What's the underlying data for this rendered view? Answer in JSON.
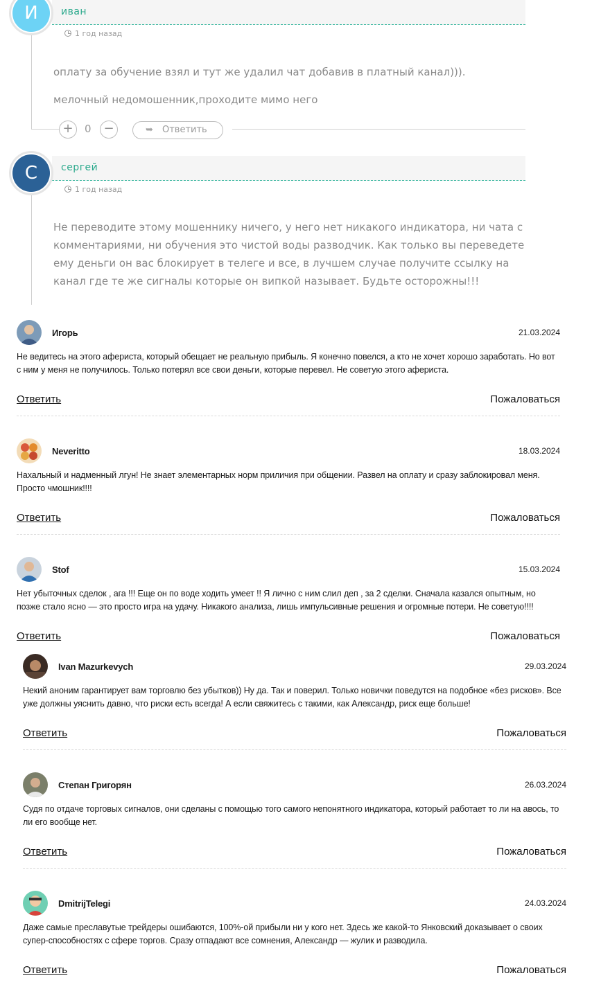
{
  "threaded_comments": [
    {
      "author": "иван",
      "avatar_letter": "И",
      "avatar_color": "#6dd3f5",
      "time": "1 год назад",
      "paragraphs": [
        "оплату за обучение взял и тут же удалил чат добавив в платный канал))).",
        "мелочный недомошенник,проходите мимо него"
      ],
      "votes": "0",
      "reply_label": "Ответить"
    },
    {
      "author": "сергей",
      "avatar_letter": "С",
      "avatar_color": "#2b6196",
      "time": "1 год назад",
      "paragraphs": [
        "Не переводите этому мошеннику ничего, у него нет никакого индикатора, ни чата с комментариями, ни обучения это чистой воды разводчик. Как только вы переведете ему деньги он вас блокирует в телеге и все, в лучшем случае получите ссылку на канал где те же сигналы которые он випкой называет. Будьте осторожны!!!"
      ]
    }
  ],
  "reviews": [
    {
      "name": "Игорь",
      "date": "21.03.2024",
      "text": "Не ведитесь на этого афериста, который обещает не реальную прибыль. Я конечно повелся, а кто не хочет хорошо заработать. Но вот с ним у меня не получилось. Только потерял все свои деньги, которые перевел. Не советую этого афериста.",
      "reply_label": "Ответить",
      "report_label": "Пожаловаться",
      "avatar_icon": "user-photo-icon"
    },
    {
      "name": "Neveritto",
      "date": "18.03.2024",
      "text": "Нахальный и надменный лгун! Не знает элементарных норм приличия при общении. Развел на оплату и сразу заблокировал меня. Просто чмошник!!!!",
      "reply_label": "Ответить",
      "report_label": "Пожаловаться",
      "avatar_icon": "matryoshka-icon"
    },
    {
      "name": "Stof",
      "date": "15.03.2024",
      "text": "Нет убыточных сделок , ага !!! Еще он по воде ходить умеет !! Я лично с ним слил деп , за 2 сделки. Сначала казался опытным, но позже стало ясно — это просто игра на удачу. Никакого анализа, лишь импульсивные решения и огромные потери. Не советую!!!!",
      "reply_label": "Ответить",
      "report_label": "Пожаловаться",
      "avatar_icon": "user-photo-icon"
    },
    {
      "name": "Ivan Mazurkevych",
      "date": "29.03.2024",
      "text": "Некий аноним гарантирует вам торговлю без убытков)) Ну да. Так и поверил. Только новички поведутся на подобное «без рисков». Все уже должны уяснить давно, что риски есть всегда! А если свяжитесь с такими, как Александр, риск еще больше!",
      "reply_label": "Ответить",
      "report_label": "Пожаловаться",
      "avatar_icon": "user-photo-icon"
    },
    {
      "name": "Степан Григорян",
      "date": "26.03.2024",
      "text": "Судя по отдаче торговых сигналов, они сделаны с помощью того самого непонятного индикатора, который работает то ли на авось, то ли его вообще нет.",
      "reply_label": "Ответить",
      "report_label": "Пожаловаться",
      "avatar_icon": "user-photo-icon"
    },
    {
      "name": "DmitrijTelegi",
      "date": "24.03.2024",
      "text": "Даже самые преславутые трейдеры ошибаются, 100%-ой прибыли ни у кого нет. Здесь же какой-то Янковский доказывает о своих супер-способностях с сфере торгов. Сразу отпадают все сомнения, Александр — жулик и разводила.",
      "reply_label": "Ответить",
      "report_label": "Пожаловаться",
      "avatar_icon": "cartoon-avatar-icon"
    }
  ]
}
